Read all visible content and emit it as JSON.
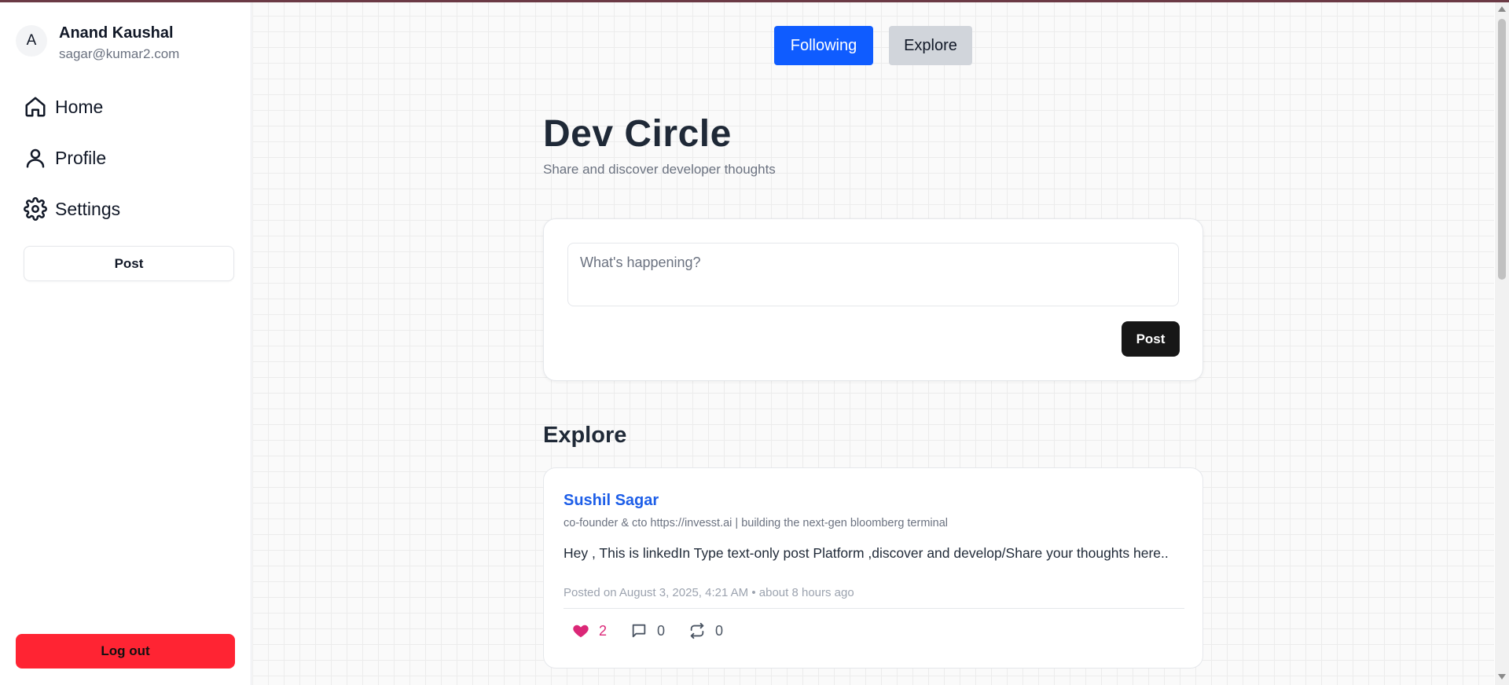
{
  "user": {
    "avatar_initial": "A",
    "name": "Anand Kaushal",
    "email": "sagar@kumar2.com"
  },
  "nav": {
    "home": "Home",
    "profile": "Profile",
    "settings": "Settings",
    "icons": [
      "home-icon",
      "user-icon",
      "gear-icon"
    ]
  },
  "sidebar": {
    "post_label": "Post",
    "logout_label": "Log out"
  },
  "tabs": {
    "following": "Following",
    "explore": "Explore",
    "active": "following"
  },
  "header": {
    "title": "Dev Circle",
    "subtitle": "Share and discover developer thoughts"
  },
  "composer": {
    "placeholder": "What's happening?",
    "value": "",
    "post_label": "Post"
  },
  "feed": {
    "section_title": "Explore",
    "posts": [
      {
        "author": "Sushil Sagar",
        "bio": "co-founder & cto https://invesst.ai | building the next-gen bloomberg terminal",
        "body": "Hey , This is linkedIn Type text-only post Platform ,discover and develop/Share your thoughts here..",
        "meta": "Posted on August 3, 2025, 4:21 AM • about 8 hours ago",
        "likes": "2",
        "comments": "0",
        "reposts": "0"
      }
    ]
  },
  "colors": {
    "accent": "#0f5cff",
    "danger": "#ff2433",
    "like": "#db2777",
    "author_link": "#1d5ee8"
  }
}
